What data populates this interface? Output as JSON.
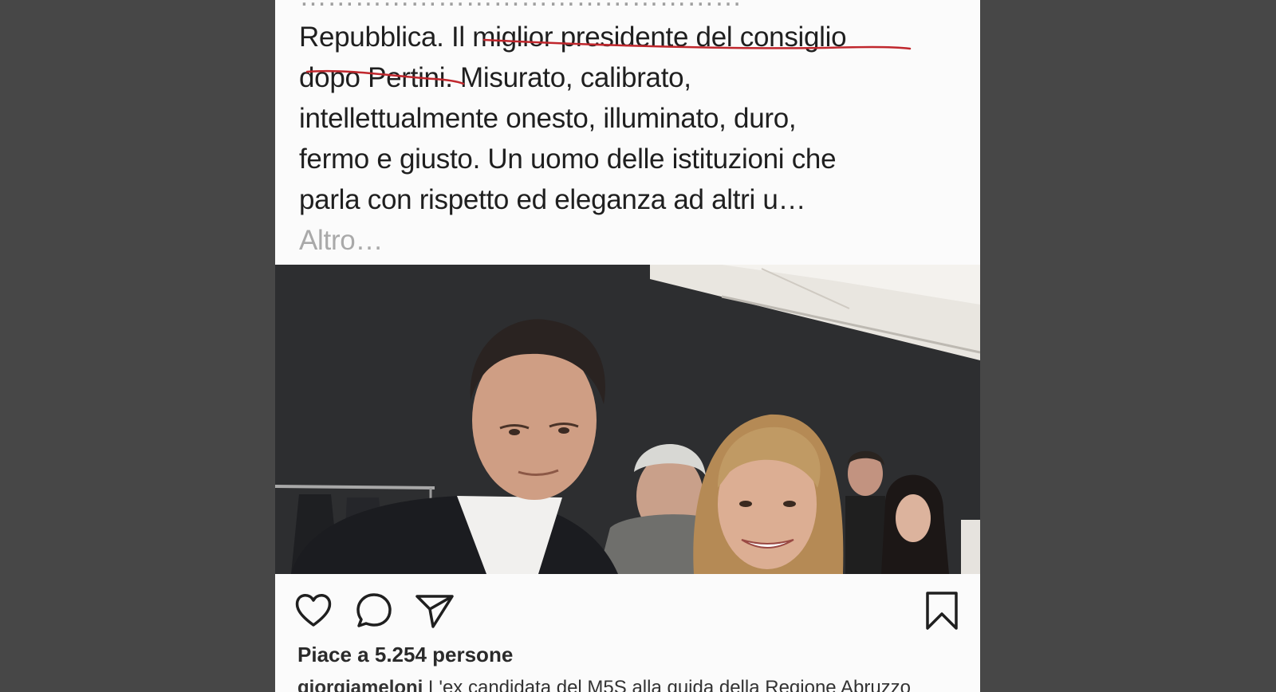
{
  "post": {
    "caption_top_partial": "…………………………………………",
    "line1_a": "Repubblica. Il ",
    "line1_b": "miglior presidente del consiglio",
    "line2_a": "dopo Pertini",
    "line2_b": ". Misurato, calibrato,",
    "line3": "intellettualmente onesto, illuminato, duro,",
    "line4": "fermo e giusto. Un uomo delle istituzioni che",
    "line5": "parla con rispetto ed eleganza ad altri u…",
    "more_label": "Altro…"
  },
  "actions": {
    "like": "heart-icon",
    "comment": "comment-icon",
    "share": "send-icon",
    "save": "bookmark-icon"
  },
  "likes_text": "Piace a 5.254 persone",
  "description": {
    "username": "giorgiameloni",
    "text": " L'ex candidata del M5S alla guida della Regione Abruzzo"
  },
  "colors": {
    "background": "#474747",
    "card": "#fbfbfb",
    "underline": "#c0272d",
    "more": "#a9a9a9"
  }
}
